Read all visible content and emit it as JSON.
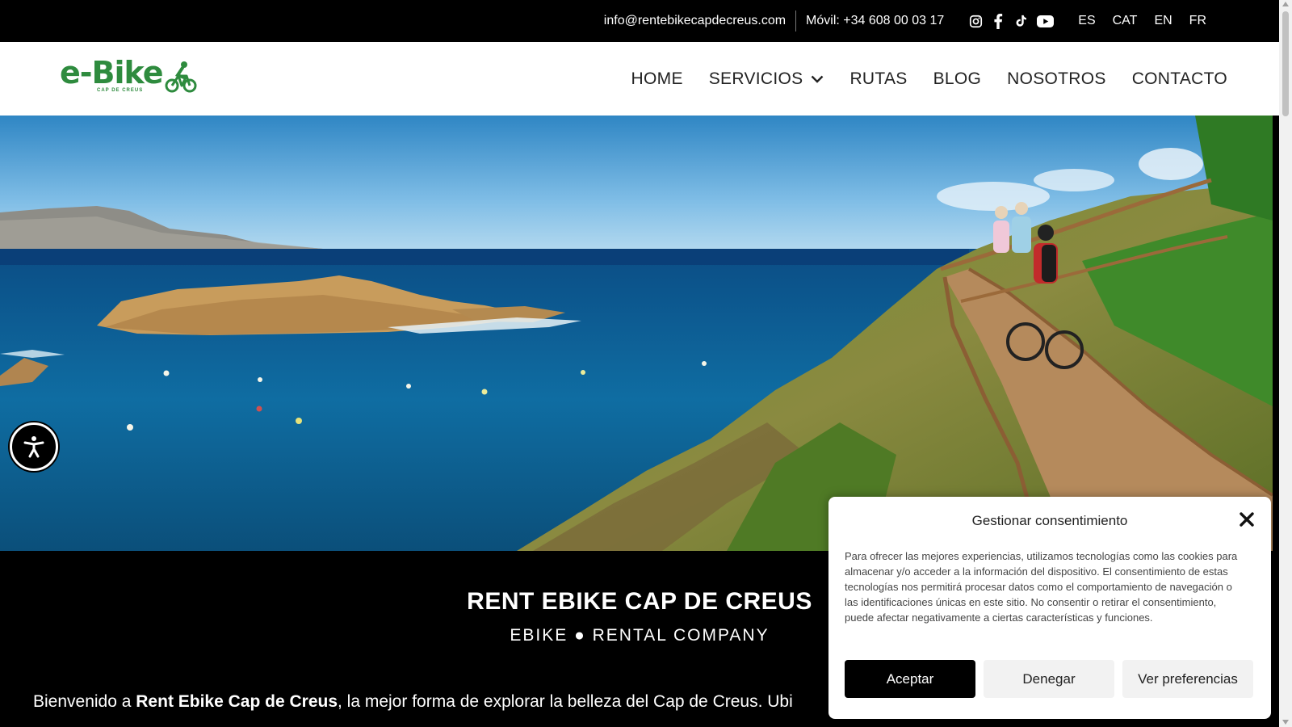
{
  "topbar": {
    "email": "info@rentebikecapdecreus.com",
    "phone": "Móvil: +34 608 00 03 17",
    "social": [
      "instagram-icon",
      "facebook-icon",
      "tiktok-icon",
      "youtube-icon"
    ],
    "languages": [
      "ES",
      "CAT",
      "EN",
      "FR"
    ]
  },
  "logo": {
    "text": "e-Bike",
    "subtitle": "CAP DE CREUS"
  },
  "nav": {
    "home": "HOME",
    "servicios": "SERVICIOS",
    "rutas": "RUTAS",
    "blog": "BLOG",
    "nosotros": "NOSOTROS",
    "contacto": "CONTACTO"
  },
  "content": {
    "title": "RENT EBIKE CAP DE CREUS",
    "subtitle": "EBIKE ● RENTAL COMPANY",
    "intro_prefix": "Bienvenido a ",
    "intro_bold": "Rent Ebike Cap de Creus",
    "intro_suffix": ", la mejor forma de explorar la belleza del Cap de Creus. Ubi"
  },
  "consent": {
    "title": "Gestionar consentimiento",
    "text": "Para ofrecer las mejores experiencias, utilizamos tecnologías como las cookies para almacenar y/o acceder a la información del dispositivo. El consentimiento de estas tecnologías nos permitirá procesar datos como el comportamiento de navegación o las identificaciones únicas en este sitio. No consentir o retirar el consentimiento, puede afectar negativamente a ciertas características y funciones.",
    "accept": "Aceptar",
    "deny": "Denegar",
    "preferences": "Ver preferencias"
  },
  "colors": {
    "brand_green": "#2e8b3e",
    "topbar_bg": "#000000",
    "sea": "#0d5c8c",
    "sky": "#6fb3e0"
  }
}
